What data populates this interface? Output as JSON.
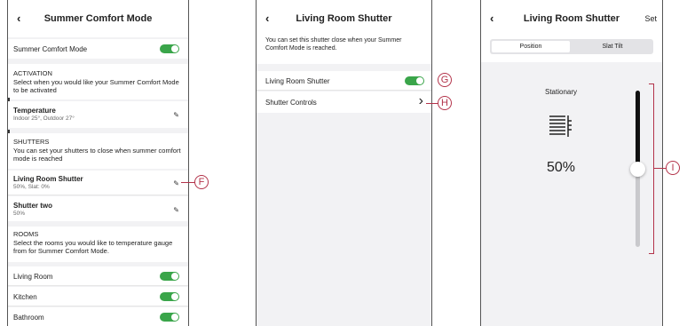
{
  "screen1": {
    "title": "Summer Comfort Mode",
    "summer_toggle_label": "Summer Comfort Mode",
    "activation": {
      "heading": "ACTIVATION",
      "desc": "Select when you would like your Summer Comfort Mode to be activated",
      "temp_title": "Temperature",
      "temp_value": "Indoor 25°, Outdoor 27°"
    },
    "shutters": {
      "heading": "SHUTTERS",
      "desc": "You can set your shutters to close when summer comfort mode is reached",
      "items": [
        {
          "name": "Living Room Shutter",
          "detail": "50%, Slat: 0%"
        },
        {
          "name": "Shutter two",
          "detail": "50%"
        }
      ]
    },
    "rooms": {
      "heading": "ROOMS",
      "desc": "Select the rooms you would like to temperature gauge from for Summer Comfort Mode.",
      "items": [
        "Living Room",
        "Kitchen",
        "Bathroom"
      ]
    }
  },
  "screen2": {
    "title": "Living Room Shutter",
    "desc": "You can set this shutter close when your Summer Comfort Mode is reached.",
    "toggle_label": "Living Room Shutter",
    "controls_label": "Shutter Controls"
  },
  "screen3": {
    "title": "Living Room Shutter",
    "set_label": "Set",
    "tabs": [
      "Position",
      "Slat Tilt"
    ],
    "status": "Stationary",
    "position_text": "50%",
    "position_value": 0.5
  },
  "callouts": {
    "f": "F",
    "g": "G",
    "h": "H",
    "i": "I"
  },
  "icons": {
    "back": "‹",
    "edit": "✎",
    "chevron": "›"
  },
  "colors": {
    "toggle_on": "#3aa54a",
    "callout": "#b3334a"
  }
}
